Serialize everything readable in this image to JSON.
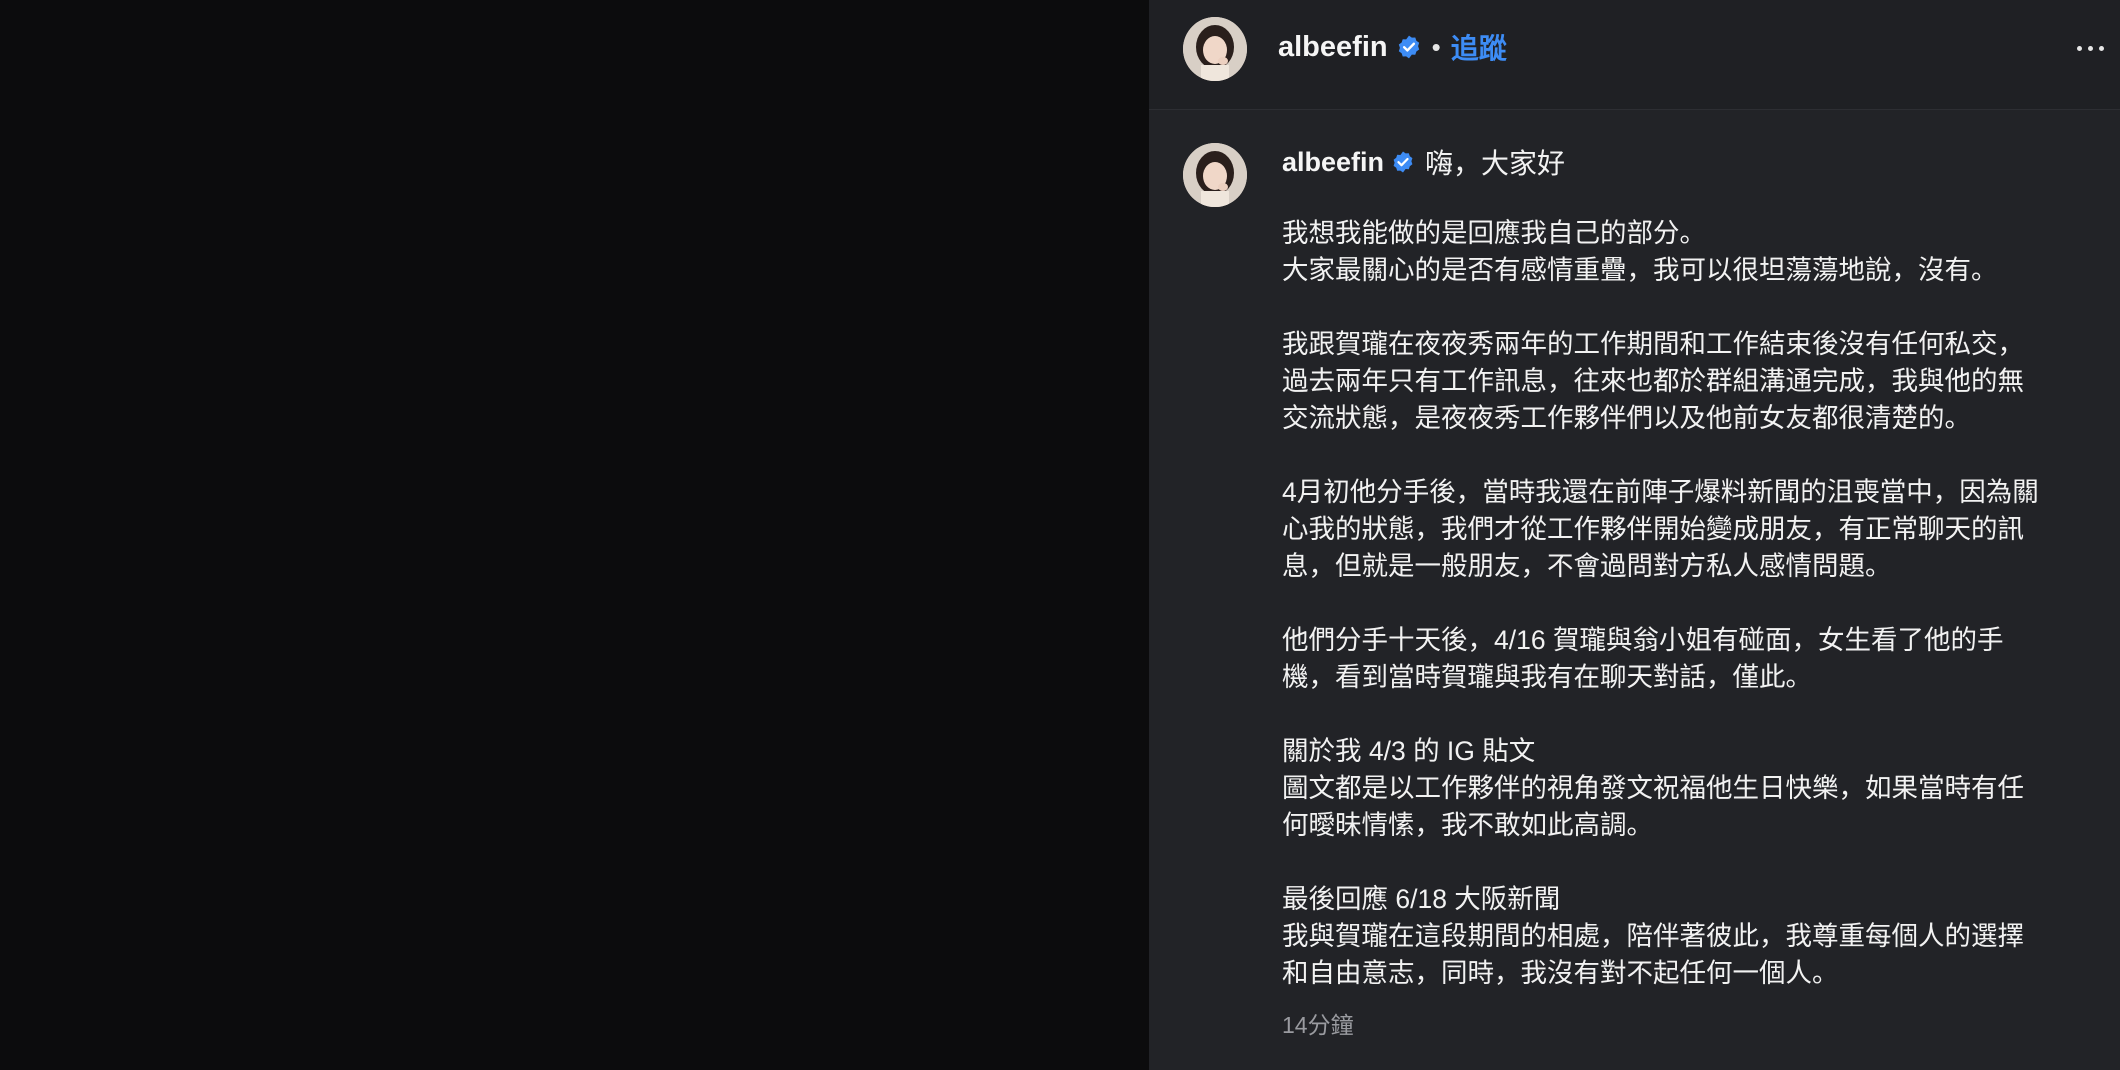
{
  "header": {
    "username": "albeefin",
    "separator": "•",
    "follow_label": "追蹤",
    "more_icon": "more-horizontal-icon"
  },
  "caption": {
    "username": "albeefin",
    "greeting": "嗨，大家好",
    "paragraphs": [
      [
        "我想我能做的是回應我自己的部分。",
        "大家最關心的是否有感情重疊，我可以很坦蕩蕩地說，沒有。"
      ],
      [
        "我跟賀瓏在夜夜秀兩年的工作期間和工作結束後沒有任何私交，",
        "過去兩年只有工作訊息，往來也都於群組溝通完成，我與他的無",
        "交流狀態，是夜夜秀工作夥伴們以及他前女友都很清楚的。"
      ],
      [
        "4月初他分手後，當時我還在前陣子爆料新聞的沮喪當中，因為關",
        "心我的狀態，我們才從工作夥伴開始變成朋友，有正常聊天的訊",
        "息，但就是一般朋友，不會過問對方私人感情問題。"
      ],
      [
        "他們分手十天後，4/16 賀瓏與翁小姐有碰面，女生看了他的手",
        "機，看到當時賀瓏與我有在聊天對話，僅此。"
      ],
      [
        "關於我 4/3 的 IG 貼文",
        "圖文都是以工作夥伴的視角發文祝福他生日快樂，如果當時有任",
        "何曖昧情愫，我不敢如此高調。"
      ],
      [
        "最後回應 6/18 大阪新聞",
        "我與賀瓏在這段期間的相處，陪伴著彼此，我尊重每個人的選擇",
        "和自由意志，同時，我沒有對不起任何一個人。"
      ]
    ],
    "timestamp": "14分鐘"
  },
  "colors": {
    "panel_bg": "#222327",
    "header_bg": "#1f2024",
    "media_bg": "#0c0c0d",
    "accent": "#3d8cf5",
    "verified": "#3d8cf5",
    "muted": "#9a9ba0"
  }
}
